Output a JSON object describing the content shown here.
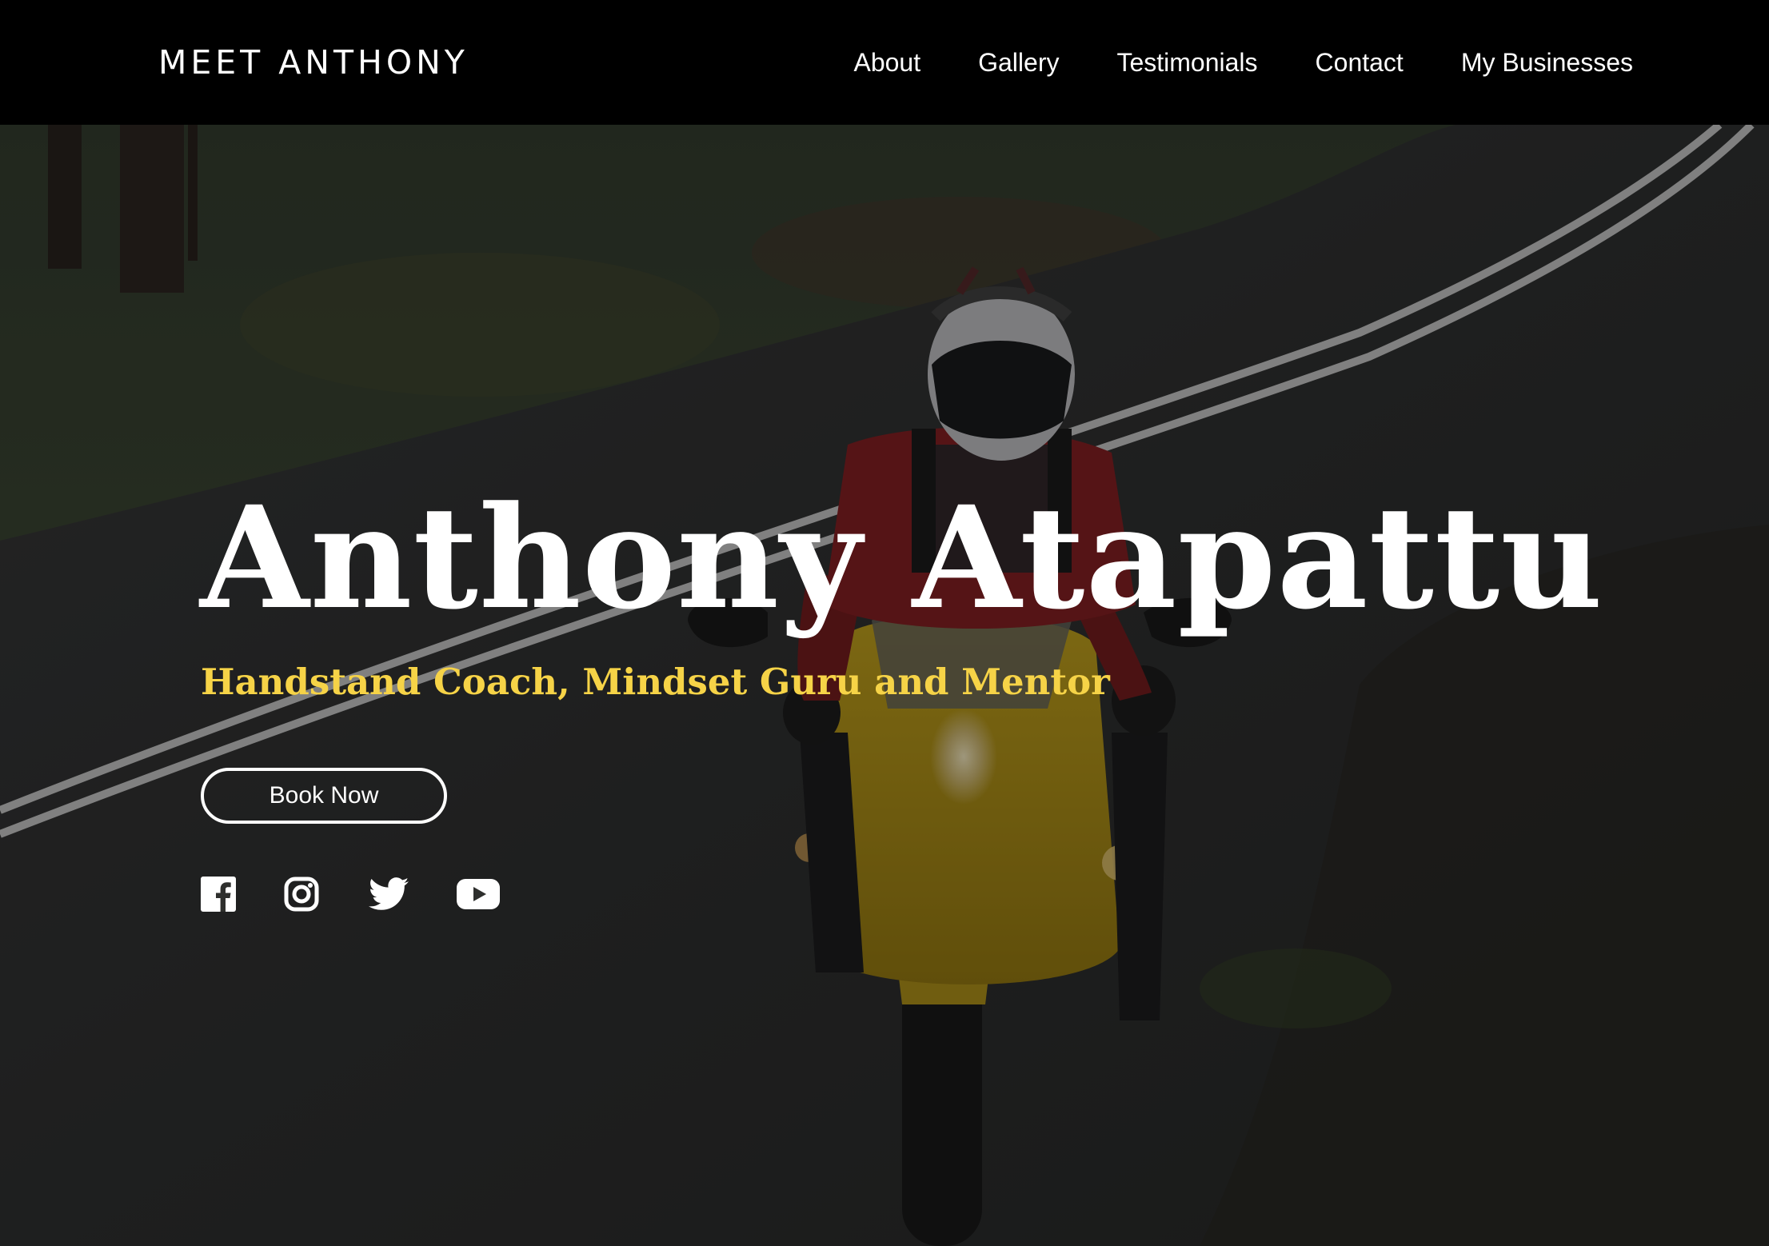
{
  "brand": {
    "name": "MEET ANTHONY"
  },
  "nav": {
    "items": [
      {
        "label": "About"
      },
      {
        "label": "Gallery"
      },
      {
        "label": "Testimonials"
      },
      {
        "label": "Contact"
      },
      {
        "label": "My Businesses"
      }
    ]
  },
  "hero": {
    "title": "Anthony Atapattu",
    "subtitle": "Handstand Coach, Mindset Guru and Mentor",
    "cta_label": "Book Now",
    "background": "motorcyclist-on-road-photo"
  },
  "social": {
    "icons": [
      "facebook-icon",
      "instagram-icon",
      "twitter-icon",
      "youtube-icon"
    ]
  },
  "colors": {
    "nav_background": "#000000",
    "text": "#ffffff",
    "accent": "#f6d347"
  }
}
